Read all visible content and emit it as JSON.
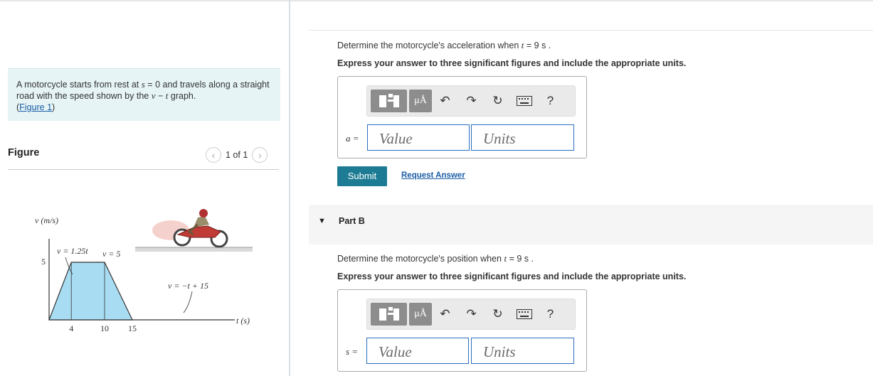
{
  "problem": {
    "text_1": "A motorcycle starts from rest at",
    "var_s": "s",
    "text_2": "= 0 and travels along a straight road with the speed shown by the",
    "var_v": "v",
    "dash": "−",
    "var_t": "t",
    "text_3": "graph.",
    "figure_link": "Figure 1",
    "paren_open": "(",
    "paren_close": ")"
  },
  "figure_panel": {
    "title": "Figure",
    "pager_text": "1 of 1",
    "prev_icon": "‹",
    "next_icon": "›"
  },
  "graph": {
    "ylabel": "v (m/s)",
    "xlabel": "t (s)",
    "y_tick": "5",
    "x_ticks": [
      "4",
      "10",
      "15"
    ],
    "eq1": "v = 1.25t",
    "eq2": "v = 5",
    "eq3": "v = −t + 15",
    "fill_color": "#a8dcf2"
  },
  "part_a": {
    "question_1": "Determine the motorcycle's acceleration when",
    "var": "t",
    "question_2": "= 9  s .",
    "instruction": "Express your answer to three significant figures and include the appropriate units.",
    "label": "a =",
    "value_placeholder": "Value",
    "units_placeholder": "Units",
    "submit": "Submit",
    "request_answer": "Request Answer"
  },
  "part_b": {
    "title": "Part B",
    "question_1": "Determine the motorcycle's position when",
    "var": "t",
    "question_2": "= 9  s .",
    "instruction": "Express your answer to three significant figures and include the appropriate units.",
    "label": "s =",
    "value_placeholder": "Value",
    "units_placeholder": "Units"
  },
  "toolbar": {
    "units_button": "μÅ",
    "undo": "↶",
    "redo": "↷",
    "reset": "↻",
    "help": "?"
  },
  "colors": {
    "accent": "#1d7c93",
    "link": "#1b5ea6",
    "problem_bg": "#e6f4f6"
  }
}
